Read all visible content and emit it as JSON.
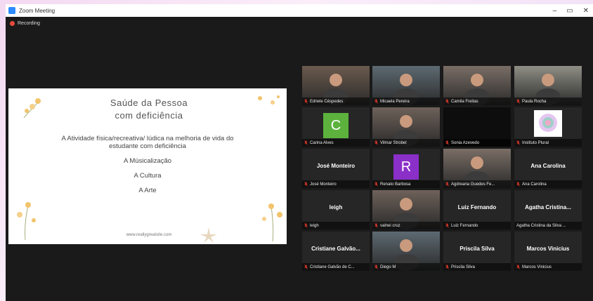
{
  "window": {
    "title": "Zoom Meeting",
    "controls": [
      "–",
      "▭",
      "✕"
    ]
  },
  "recording": {
    "label": "Recording"
  },
  "slide": {
    "title_line1": "Saúde da Pessoa",
    "title_line2": "com deficiência",
    "line1a": "A Atividade física/recreativa/ lúdica na melhoria de vida do",
    "line1b": "estudante com deficiência",
    "line2": "A Músicalização",
    "line3": "A Cultura",
    "line4": "A Arte",
    "url": "www.reallygreatsite.com"
  },
  "participants": [
    {
      "label": "Edriele Céspedes",
      "type": "video"
    },
    {
      "label": "Micaela Pereira",
      "type": "video"
    },
    {
      "label": "Camila Freitas",
      "type": "video"
    },
    {
      "label": "Paula Rocha",
      "type": "video",
      "active": true
    },
    {
      "label": "Carina Alves",
      "type": "avatar",
      "initial": "C",
      "color": "#5cb23c"
    },
    {
      "label": "Vilmar Strobel",
      "type": "video"
    },
    {
      "label": "Sonia Azevedo",
      "type": "blank"
    },
    {
      "label": "Instituto Plural",
      "type": "logo"
    },
    {
      "label": "José Monteiro",
      "display": "José Monteiro",
      "type": "name"
    },
    {
      "label": "Renato Barbosa",
      "type": "avatar",
      "initial": "R",
      "color": "#8b2fc9"
    },
    {
      "label": "Agdreana Guedes Fe...",
      "type": "video"
    },
    {
      "label": "Ana Carolina",
      "display": "Ana Carolina",
      "type": "name"
    },
    {
      "label": "leigh",
      "display": "leigh",
      "type": "name"
    },
    {
      "label": "valnei cruz",
      "type": "video"
    },
    {
      "label": "Luiz Fernando",
      "display": "Luiz Fernando",
      "type": "name"
    },
    {
      "label": "Agatha Cristina da Silva ...",
      "display": "Agatha Cristina...",
      "type": "name",
      "nomic": true
    },
    {
      "label": "Cristiane Galvão de C...",
      "display": "Cristiane Galvão...",
      "type": "name"
    },
    {
      "label": "Diego M",
      "type": "video"
    },
    {
      "label": "Priscila Silva",
      "display": "Priscila Silva",
      "type": "name"
    },
    {
      "label": "Marcos Vinicius",
      "display": "Marcos Vinicius",
      "type": "name"
    }
  ],
  "colors": {
    "muted_mic": "#e8392c",
    "active_border": "#b8d94d",
    "background": "#1a1a1a"
  }
}
